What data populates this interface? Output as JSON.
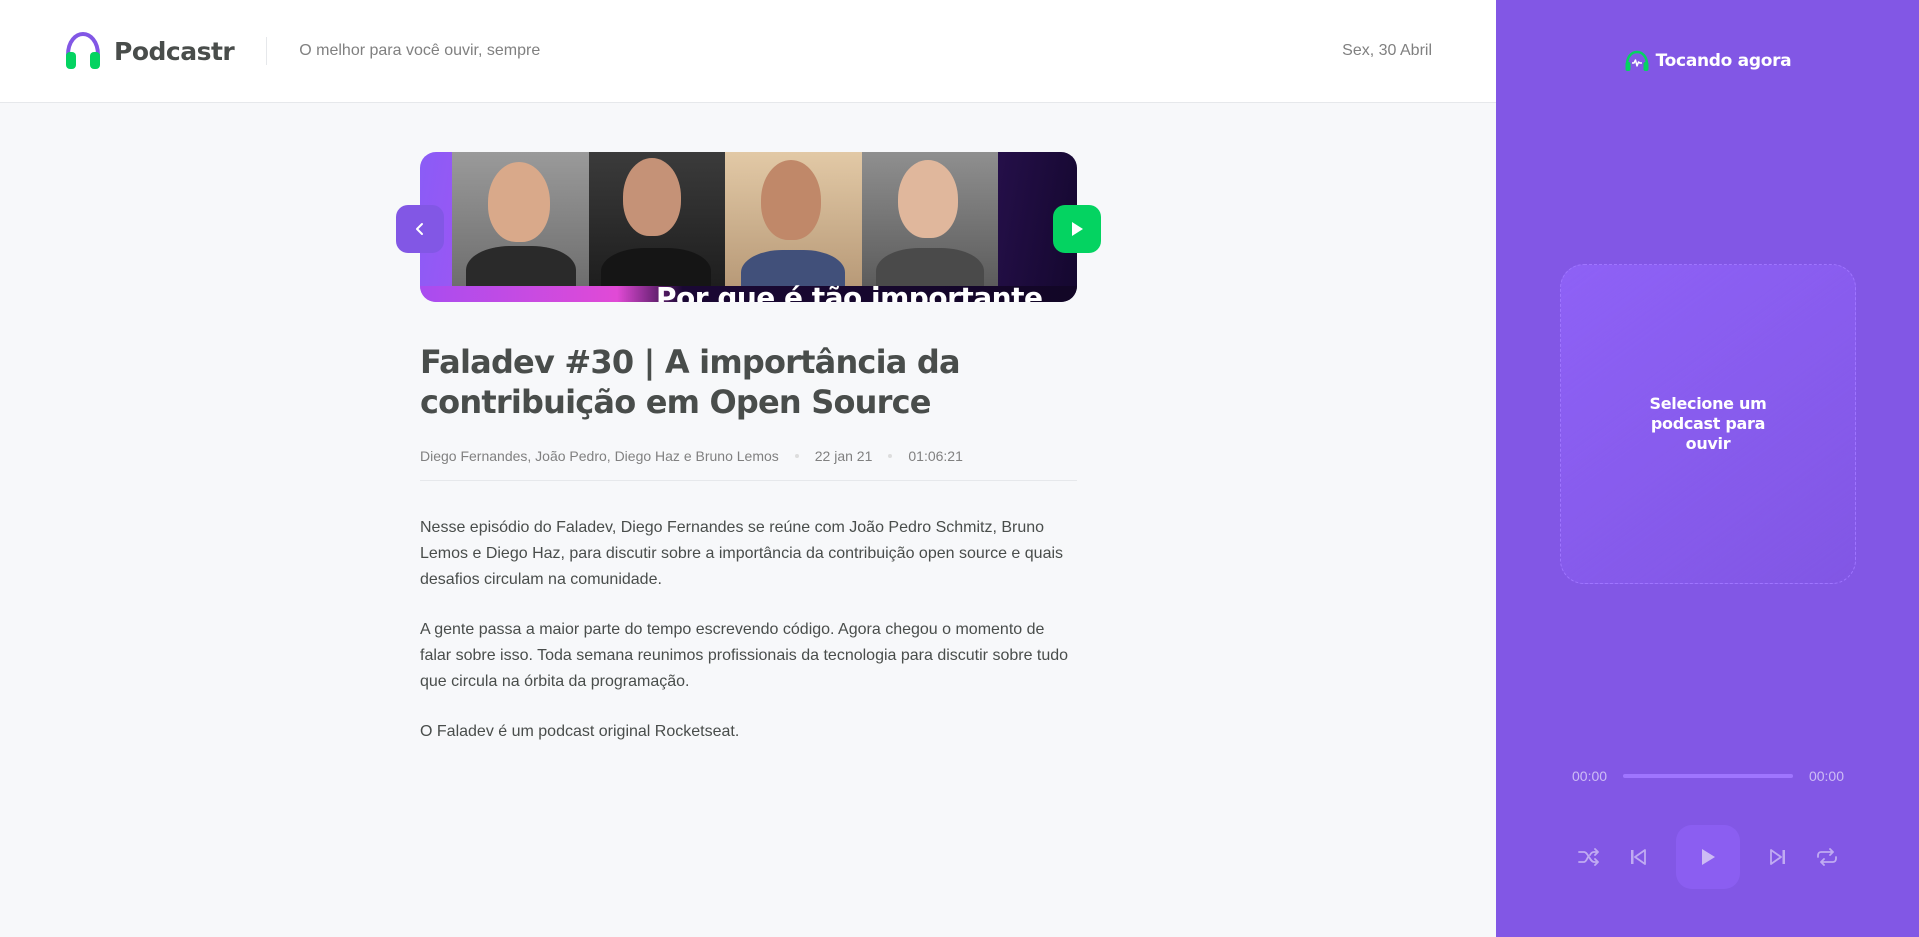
{
  "header": {
    "app_name": "Podcastr",
    "tagline": "O melhor para você ouvir, sempre",
    "date": "Sex, 30 Abril"
  },
  "episode": {
    "thumbnail_caption": "Por que é tão importante",
    "title": "Faladev #30 | A importância da contribuição em Open Source",
    "members": "Diego Fernandes, João Pedro, Diego Haz e Bruno Lemos",
    "published_at": "22 jan 21",
    "duration": "01:06:21",
    "description": [
      "Nesse episódio do Faladev, Diego Fernandes se reúne com João Pedro Schmitz, Bruno Lemos e Diego Haz, para discutir sobre a importância da contribuição open source e quais desafios circulam na comunidade.",
      "A gente passa a maior parte do tempo escrevendo código. Agora chegou o momento de falar sobre isso. Toda semana reunimos profissionais da tecnologia para discutir sobre tudo que circula na órbita da programação.",
      "O Faladev é um podcast original Rocketseat."
    ]
  },
  "player": {
    "heading": "Tocando agora",
    "empty_message": "Selecione um podcast para ouvir",
    "current_time": "00:00",
    "total_time": "00:00",
    "progress": 0
  },
  "colors": {
    "brand_purple": "#8257e5",
    "accent_green": "#04d361",
    "text_dark": "#494d4b",
    "text_muted": "#808080"
  },
  "icons": {
    "logo": "headphones-icon",
    "back": "chevron-left-icon",
    "play_episode": "play-icon",
    "player_heading": "headphones-playing-icon",
    "shuffle": "shuffle-icon",
    "previous": "skip-previous-icon",
    "play": "play-icon",
    "next": "skip-next-icon",
    "repeat": "repeat-icon"
  }
}
